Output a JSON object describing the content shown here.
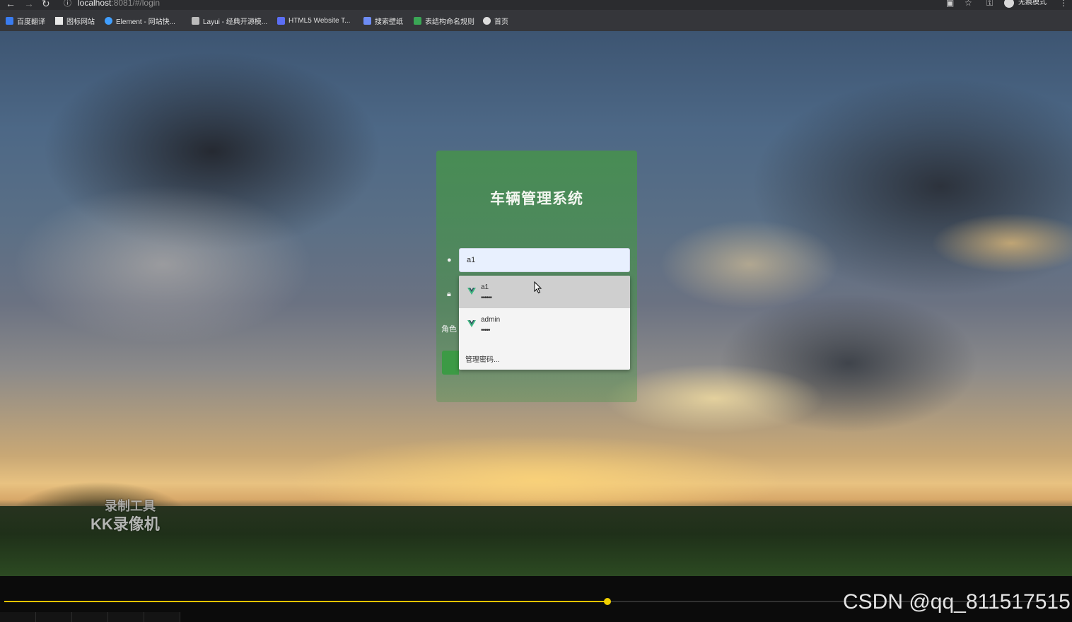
{
  "browser": {
    "url_host": "localhost",
    "url_path": ":8081/#/login",
    "incognito_label": "无痕模式"
  },
  "bookmarks": [
    {
      "label": "百度翻译",
      "icon": "translate-icon",
      "color": "#3a7cf0"
    },
    {
      "label": "图标网站",
      "icon": "flag-icon",
      "color": "#e8e8e8"
    },
    {
      "label": "Element - 网站快...",
      "icon": "element-icon",
      "color": "#409eff"
    },
    {
      "label": "Layui - 经典开源模...",
      "icon": "layui-icon",
      "color": "#cccccc"
    },
    {
      "label": "HTML5 Website T...",
      "icon": "html5-icon",
      "color": "#5b6ef5"
    },
    {
      "label": "搜索壁纸",
      "icon": "wallpaper-icon",
      "color": "#6d8cf5"
    },
    {
      "label": "表结构命名规则",
      "icon": "table-icon",
      "color": "#3aa655"
    },
    {
      "label": "首页",
      "icon": "globe-icon",
      "color": "#dddddd"
    }
  ],
  "login": {
    "title": "车辆管理系统",
    "username_value": "a1",
    "role_label": "角色"
  },
  "autocomplete": {
    "items": [
      {
        "username": "a1",
        "password_mask": "••••••"
      },
      {
        "username": "admin",
        "password_mask": "•••••"
      }
    ],
    "manage_label": "管理密码..."
  },
  "watermark": {
    "line1": "录制工具",
    "line2": "KK录像机"
  },
  "player": {
    "progress": 0.567,
    "accent_color": "#e5c400"
  },
  "credit": "CSDN @qq_811517515"
}
